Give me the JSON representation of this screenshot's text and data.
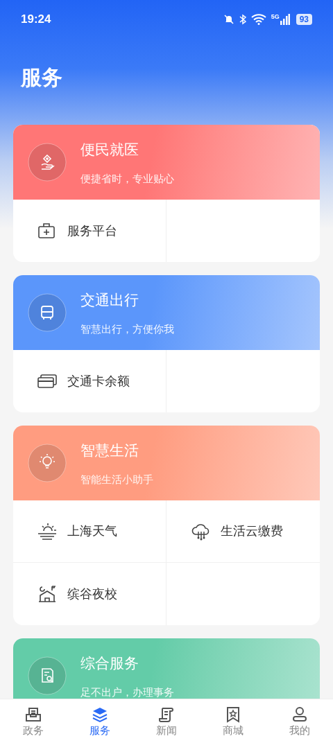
{
  "status_bar": {
    "time": "19:24",
    "network": "5G",
    "battery": "93"
  },
  "title": "服务",
  "cards": [
    {
      "title": "便民就医",
      "subtitle": "便捷省时，专业贴心",
      "color": "#ff7676",
      "items": [
        {
          "label": "服务平台"
        }
      ]
    },
    {
      "title": "交通出行",
      "subtitle": "智慧出行，方便你我",
      "color": "#5b96fb",
      "items": [
        {
          "label": "交通卡余额"
        }
      ]
    },
    {
      "title": "智慧生活",
      "subtitle": "智能生活小助手",
      "color": "#ff9c80",
      "items": [
        {
          "label": "上海天气"
        },
        {
          "label": "生活云缴费"
        },
        {
          "label": "缤谷夜校"
        }
      ]
    },
    {
      "title": "综合服务",
      "subtitle": "足不出户，办理事务",
      "color": "#63cca8"
    }
  ],
  "tab_bar": [
    {
      "label": "政务",
      "selected": false
    },
    {
      "label": "服务",
      "selected": true
    },
    {
      "label": "新闻",
      "selected": false
    },
    {
      "label": "商城",
      "selected": false
    },
    {
      "label": "我的",
      "selected": false
    }
  ]
}
